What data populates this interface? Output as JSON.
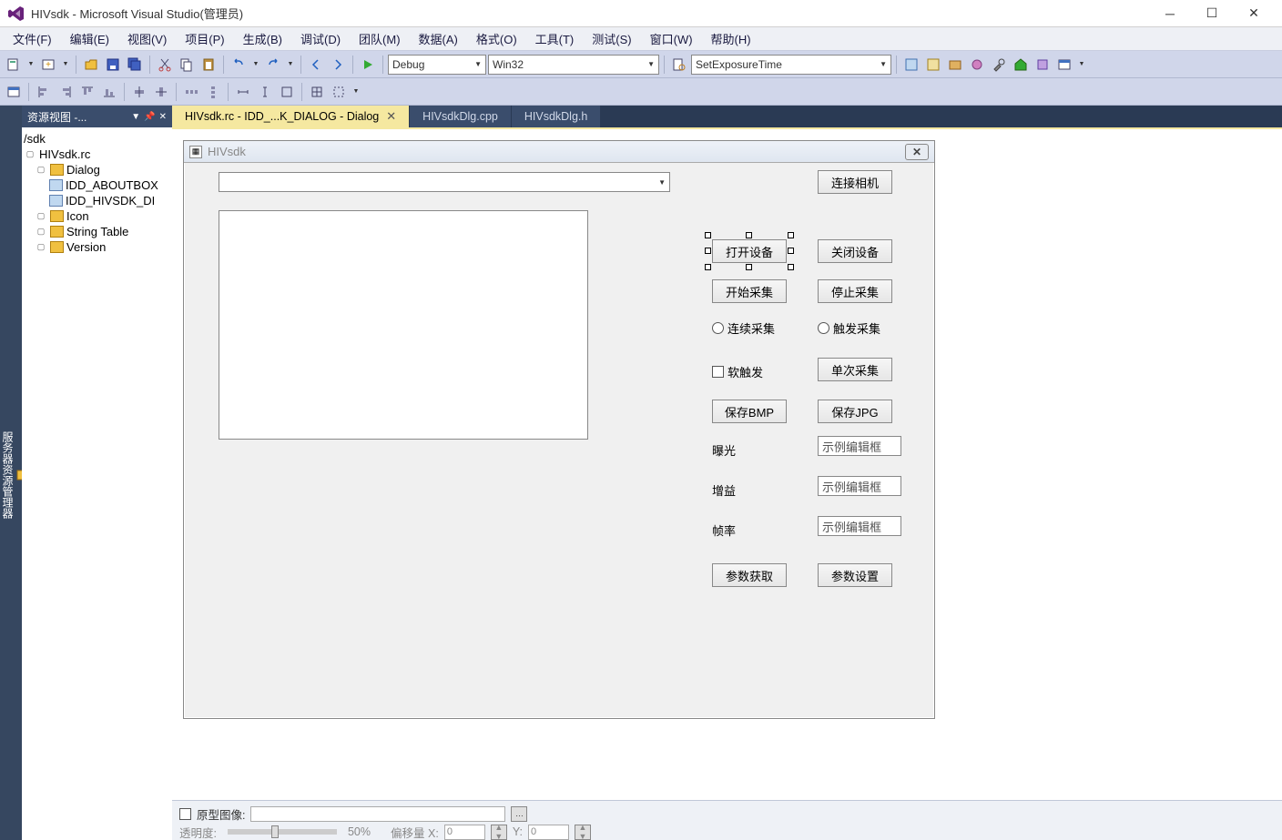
{
  "title": "HIVsdk - Microsoft Visual Studio(管理员)",
  "menu": [
    "文件(F)",
    "编辑(E)",
    "视图(V)",
    "项目(P)",
    "生成(B)",
    "调试(D)",
    "团队(M)",
    "数据(A)",
    "格式(O)",
    "工具(T)",
    "测试(S)",
    "窗口(W)",
    "帮助(H)"
  ],
  "toolbar1": {
    "config": "Debug",
    "platform": "Win32",
    "search": "SetExposureTime"
  },
  "sidebar_vert": "服务器资源管理器",
  "respanel": {
    "title": "资源视图 -...",
    "root": "/sdk",
    "items": [
      {
        "label": "HIVsdk.rc",
        "depth": 0
      },
      {
        "label": "Dialog",
        "depth": 1,
        "folder": true
      },
      {
        "label": "IDD_ABOUTBOX",
        "depth": 2,
        "dlg": true
      },
      {
        "label": "IDD_HIVSDK_DI",
        "depth": 2,
        "dlg": true
      },
      {
        "label": "Icon",
        "depth": 1,
        "folder": true
      },
      {
        "label": "String Table",
        "depth": 1,
        "folder": true
      },
      {
        "label": "Version",
        "depth": 1,
        "folder": true
      }
    ]
  },
  "tabs": [
    {
      "label": "HIVsdk.rc - IDD_...K_DIALOG - Dialog",
      "active": true,
      "closable": true
    },
    {
      "label": "HIVsdkDlg.cpp",
      "active": false
    },
    {
      "label": "HIVsdkDlg.h",
      "active": false
    }
  ],
  "dialog": {
    "title": "HIVsdk",
    "buttons": {
      "connect": "连接相机",
      "open": "打开设备",
      "close": "关闭设备",
      "start": "开始采集",
      "stop": "停止采集",
      "savebmp": "保存BMP",
      "savejpg": "保存JPG",
      "getparam": "参数获取",
      "setparam": "参数设置",
      "single": "单次采集"
    },
    "radios": {
      "cont": "连续采集",
      "trig": "触发采集"
    },
    "checks": {
      "soft": "软触发"
    },
    "labels": {
      "exp": "曝光",
      "gain": "增益",
      "fps": "帧率"
    },
    "editplaceholder": "示例编辑框"
  },
  "bottom": {
    "orig": "原型图像:",
    "opacity": "透明度:",
    "opval": "50%",
    "offx": "偏移量 X:",
    "x": "0",
    "yl": "Y:",
    "y": "0"
  }
}
